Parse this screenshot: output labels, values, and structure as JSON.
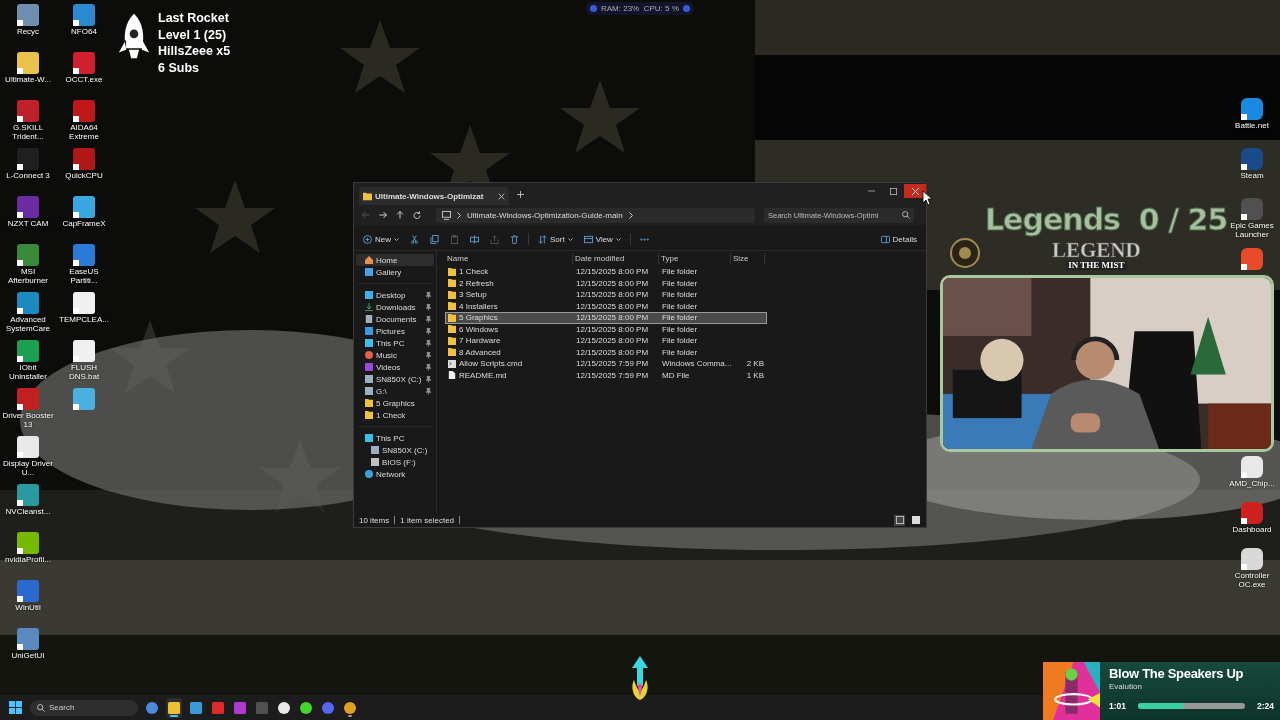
{
  "stream_overlay": {
    "lines": [
      "Last Rocket",
      "Level 1  (25)",
      "HillsZeee x5",
      "6 Subs"
    ]
  },
  "perf_overlay": {
    "text": "RAM: 23%  CPU: 5 %"
  },
  "desktop_left_column_1": [
    {
      "label": "Recyc",
      "color": "#6f8fb0"
    },
    {
      "label": "Ultimate-W...",
      "color": "#e8c24a"
    },
    {
      "label": "G.SKILL Trident...",
      "color": "#c0202a"
    },
    {
      "label": "L-Connect 3",
      "color": "#202020"
    },
    {
      "label": "NZXT CAM",
      "color": "#6a2ca0"
    },
    {
      "label": "MSI Afterburner",
      "color": "#3a8a3a"
    },
    {
      "label": "Advanced SystemCare",
      "color": "#1a8ac0"
    },
    {
      "label": "IObit Uninstaller",
      "color": "#1aa050"
    },
    {
      "label": "Driver Booster 13",
      "color": "#c02020"
    },
    {
      "label": "Display Driver U...",
      "color": "#e8e8e8"
    },
    {
      "label": "NVCleanst...",
      "color": "#2a9aa0"
    },
    {
      "label": "nvidiaProfil...",
      "color": "#76b900"
    },
    {
      "label": "WinUtil",
      "color": "#2a6ad0"
    },
    {
      "label": "UniGetUI",
      "color": "#5a8ac0"
    }
  ],
  "desktop_left_column_2": [
    {
      "label": "NFO64",
      "color": "#2a8ad0"
    },
    {
      "label": "OCCT.exe",
      "color": "#d02030"
    },
    {
      "label": "AIDA64 Extreme",
      "color": "#c01818"
    },
    {
      "label": "QuickCPU",
      "color": "#b01818"
    },
    {
      "label": "CapFrameX",
      "color": "#3aa8e0"
    },
    {
      "label": "EaseUS Partiti...",
      "color": "#2a7ad8"
    },
    {
      "label": "TEMPCLEA...",
      "color": "#f0f0f0"
    },
    {
      "label": "FLUSH DNS.bat",
      "color": "#f0f0f0"
    },
    {
      "color": "#4ab0e0"
    }
  ],
  "desktop_right_top": [
    {
      "label": "Battle.net",
      "color": "#1a8ae0"
    },
    {
      "label": "Steam",
      "color": "#1a4a8a"
    },
    {
      "label": "Epic Games Launcher",
      "color": "#505050"
    },
    {
      "color": "#e84a2a"
    }
  ],
  "desktop_right_bottom": [
    {
      "label": "AMD_Chip...",
      "color": "#e8e8e8"
    },
    {
      "label": "Dashboard",
      "color": "#d02020"
    },
    {
      "label": "Controller OC.exe",
      "color": "#d8d8d8"
    }
  ],
  "goal_overlay": {
    "title": "Legends  0 / 25",
    "logo_line_1": "LEGEND",
    "logo_line_2": "IN THE MIST"
  },
  "explorer": {
    "tab_title": "Ultimate-Windows-Optimizat",
    "back_disabled": true,
    "address": "Ultimate-Windows-Optimization-Guide-main",
    "search_placeholder": "Search Ultimate-Windows-Optimi",
    "toolbar": [
      {
        "kind": "new",
        "label": "New",
        "disabled": false
      },
      {
        "kind": "cut",
        "disabled": false
      },
      {
        "kind": "copy",
        "disabled": false
      },
      {
        "kind": "paste",
        "disabled": true
      },
      {
        "kind": "rename",
        "disabled": false
      },
      {
        "kind": "share",
        "disabled": true
      },
      {
        "kind": "delete",
        "disabled": false
      },
      {
        "kind": "sort",
        "label": "Sort",
        "disabled": false
      },
      {
        "kind": "view",
        "label": "View",
        "disabled": false
      },
      {
        "kind": "more",
        "disabled": false
      }
    ],
    "details_label": "Details",
    "sidebar_sections": [
      [
        {
          "label": "Home",
          "kind": "home",
          "selected": true,
          "pinned": false
        },
        {
          "label": "Gallery",
          "kind": "gallery",
          "selected": false,
          "pinned": false
        }
      ],
      [
        {
          "label": "Desktop",
          "kind": "desktop",
          "selected": false,
          "pinned": true
        },
        {
          "label": "Downloads",
          "kind": "downloads",
          "selected": false,
          "pinned": true
        },
        {
          "label": "Documents",
          "kind": "documents",
          "selected": false,
          "pinned": true
        },
        {
          "label": "Pictures",
          "kind": "pictures",
          "selected": false,
          "pinned": true
        },
        {
          "label": "This PC",
          "kind": "pc",
          "selected": false,
          "pinned": true
        },
        {
          "label": "Music",
          "kind": "music",
          "selected": false,
          "pinned": true
        },
        {
          "label": "Videos",
          "kind": "videos",
          "selected": false,
          "pinned": true
        },
        {
          "label": "SN850X (C:)",
          "kind": "drive",
          "selected": false,
          "pinned": true
        },
        {
          "label": "G:\\",
          "kind": "drive",
          "selected": false,
          "pinned": true
        },
        {
          "label": "5 Graphics",
          "kind": "folder",
          "selected": false,
          "pinned": false
        },
        {
          "label": "1 Check",
          "kind": "folder",
          "selected": false,
          "pinned": false
        }
      ],
      [
        {
          "label": "This PC",
          "kind": "pc",
          "selected": false,
          "pinned": false,
          "children": [
            {
              "label": "SN850X (C:)",
              "kind": "drive",
              "selected": false,
              "pinned": false
            },
            {
              "label": "BIOS (F:)",
              "kind": "usb",
              "selected": false,
              "pinned": false
            }
          ]
        },
        {
          "label": "Network",
          "kind": "network",
          "selected": false,
          "pinned": false
        }
      ]
    ],
    "columns": [
      "Name",
      "Date modified",
      "Type",
      "Size"
    ],
    "rows": [
      {
        "name": "1 Check",
        "date": "12/15/2025 8:00 PM",
        "type": "File folder",
        "kind": "folder",
        "selected": false
      },
      {
        "name": "2 Refresh",
        "date": "12/15/2025 8:00 PM",
        "type": "File folder",
        "kind": "folder",
        "selected": false
      },
      {
        "name": "3 Setup",
        "date": "12/15/2025 8:00 PM",
        "type": "File folder",
        "kind": "folder",
        "selected": false
      },
      {
        "name": "4 Installers",
        "date": "12/15/2025 8:00 PM",
        "type": "File folder",
        "kind": "folder",
        "selected": false
      },
      {
        "name": "5 Graphics",
        "date": "12/15/2025 8:00 PM",
        "type": "File folder",
        "kind": "folder",
        "selected": true
      },
      {
        "name": "6 Windows",
        "date": "12/15/2025 8:00 PM",
        "type": "File folder",
        "kind": "folder",
        "selected": false
      },
      {
        "name": "7 Hardware",
        "date": "12/15/2025 8:00 PM",
        "type": "File folder",
        "kind": "folder",
        "selected": false
      },
      {
        "name": "8 Advanced",
        "date": "12/15/2025 8:00 PM",
        "type": "File folder",
        "kind": "folder",
        "selected": false
      },
      {
        "name": "Allow Scripts.cmd",
        "date": "12/15/2025 7:59 PM",
        "type": "Windows Comma...",
        "size": "2 KB",
        "kind": "script",
        "selected": false
      },
      {
        "name": "README.md",
        "date": "12/15/2025 7:59 PM",
        "type": "MD File",
        "size": "1 KB",
        "kind": "file",
        "selected": false
      }
    ],
    "status": {
      "count": "10 items",
      "selection": "1 item selected"
    },
    "view_modes": [
      {
        "kind": "details",
        "selected": true
      },
      {
        "kind": "tiles",
        "selected": false
      }
    ]
  },
  "now_playing": {
    "title": "Blow The Speakers Up",
    "artist": "Evalution",
    "elapsed": "1:01",
    "level": 0.42,
    "duration": "2:24"
  },
  "taskbar": {
    "search_placeholder": "Search",
    "apps": [
      {
        "kind": "settings",
        "color": "#4a8ad8",
        "focused": false,
        "open": false
      },
      {
        "kind": "explorer",
        "color": "#f0c030",
        "focused": true,
        "open": true
      },
      {
        "kind": "photos",
        "color": "#3a9ad8",
        "focused": false,
        "open": false
      },
      {
        "kind": "remote",
        "color": "#e02a2a",
        "focused": false,
        "open": false
      },
      {
        "kind": "media",
        "color": "#b03ad0",
        "focused": false,
        "open": false
      },
      {
        "kind": "gpu",
        "color": "#505050",
        "focused": false,
        "open": false
      },
      {
        "kind": "engine",
        "color": "#e8e8e8",
        "focused": false,
        "open": false
      },
      {
        "kind": "razer",
        "color": "#44d62c",
        "focused": false,
        "open": false
      },
      {
        "kind": "discord",
        "color": "#5865f2",
        "focused": false,
        "open": false
      },
      {
        "kind": "chrome",
        "color": "#e0a020",
        "focused": false,
        "open": true
      }
    ]
  }
}
